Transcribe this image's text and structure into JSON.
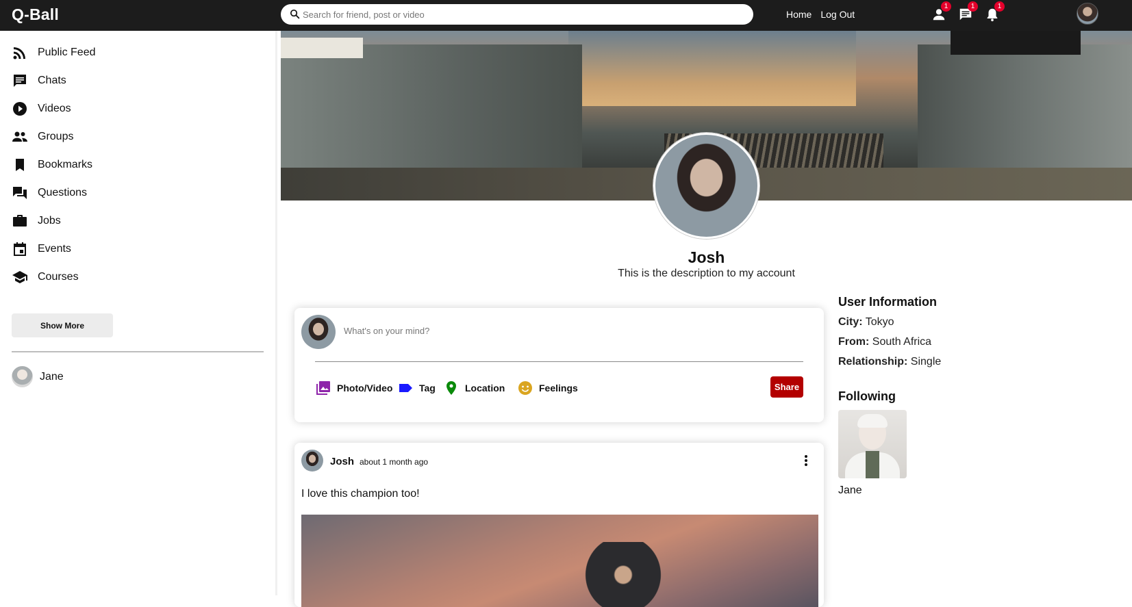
{
  "app": {
    "title": "Q-Ball"
  },
  "search": {
    "placeholder": "Search for friend, post or video"
  },
  "topnav": {
    "links": [
      "Home",
      "Log Out"
    ],
    "badges": {
      "friends": "1",
      "messages": "1",
      "notifications": "1"
    }
  },
  "sidebar": {
    "items": [
      {
        "label": "Public Feed",
        "icon": "rss-icon"
      },
      {
        "label": "Chats",
        "icon": "chat-icon"
      },
      {
        "label": "Videos",
        "icon": "play-circle-icon"
      },
      {
        "label": "Groups",
        "icon": "group-icon"
      },
      {
        "label": "Bookmarks",
        "icon": "bookmark-icon"
      },
      {
        "label": "Questions",
        "icon": "question-answer-icon"
      },
      {
        "label": "Jobs",
        "icon": "briefcase-icon"
      },
      {
        "label": "Events",
        "icon": "calendar-icon"
      },
      {
        "label": "Courses",
        "icon": "school-icon"
      }
    ],
    "show_more": "Show More",
    "friends": [
      {
        "name": "Jane"
      }
    ]
  },
  "profile": {
    "name": "Josh",
    "description": "This is the description to my account"
  },
  "composer": {
    "placeholder": "What's on your mind?",
    "options": [
      {
        "label": "Photo/Video",
        "icon": "photo-library-icon",
        "color": "#8e24aa"
      },
      {
        "label": "Tag",
        "icon": "label-icon",
        "color": "#1a1aff"
      },
      {
        "label": "Location",
        "icon": "location-pin-icon",
        "color": "#0a8a0a"
      },
      {
        "label": "Feelings",
        "icon": "emoji-icon",
        "color": "#daa520"
      }
    ],
    "share": "Share"
  },
  "post": {
    "author": "Josh",
    "time": "about 1 month ago",
    "text": "I love this champion too!"
  },
  "user_info": {
    "title": "User Information",
    "rows": [
      {
        "label": "City:",
        "value": "Tokyo"
      },
      {
        "label": "From:",
        "value": "South Africa"
      },
      {
        "label": "Relationship:",
        "value": "Single"
      }
    ],
    "following_title": "Following",
    "following": [
      {
        "name": "Jane"
      }
    ]
  },
  "colors": {
    "topbar": "#1c1c1c",
    "share": "#b30000",
    "badge": "#e4002b"
  }
}
